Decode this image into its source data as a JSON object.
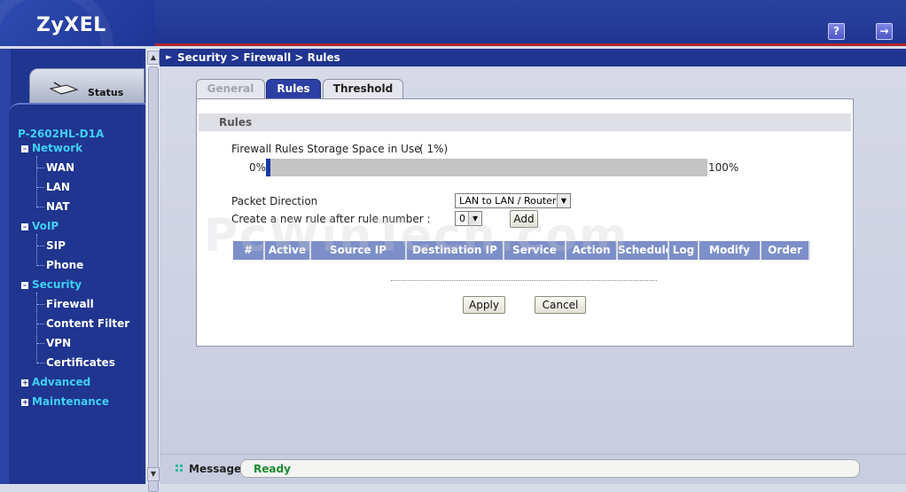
{
  "header": {
    "logo": "ZyXEL",
    "help_icon": "help-icon",
    "logout_icon": "logout-icon"
  },
  "sidebar": {
    "status_label": "Status",
    "model": "P-2602HL-D1A",
    "tree": [
      {
        "label": "Network",
        "expanded": true,
        "children": [
          "WAN",
          "LAN",
          "NAT"
        ]
      },
      {
        "label": "VoIP",
        "expanded": true,
        "children": [
          "SIP",
          "Phone"
        ]
      },
      {
        "label": "Security",
        "expanded": true,
        "children": [
          "Firewall",
          "Content Filter",
          "VPN",
          "Certificates"
        ]
      },
      {
        "label": "Advanced",
        "expanded": false,
        "children": []
      },
      {
        "label": "Maintenance",
        "expanded": false,
        "children": []
      }
    ]
  },
  "breadcrumb": "Security > Firewall > Rules",
  "tabs": [
    {
      "label": "General",
      "active": false
    },
    {
      "label": "Rules",
      "active": true
    },
    {
      "label": "Threshold",
      "active": false
    }
  ],
  "section_title": "Rules",
  "storage": {
    "label": "Firewall Rules Storage Space in Use",
    "percent_text": "( 1%)",
    "percent": 1,
    "min_label": "0%",
    "max_label": "100%"
  },
  "direction": {
    "label": "Packet Direction",
    "value": "LAN to LAN / Router"
  },
  "new_rule": {
    "label": "Create a new rule after rule number :",
    "value": "0",
    "add_label": "Add"
  },
  "table": {
    "headers": [
      "#",
      "Active",
      "Source IP",
      "Destination IP",
      "Service",
      "Action",
      "Schedule",
      "Log",
      "Modify",
      "Order"
    ],
    "rows": []
  },
  "buttons": {
    "apply": "Apply",
    "cancel": "Cancel"
  },
  "watermark": "PcWinTech.com",
  "footer": {
    "message_label": "Message",
    "message": "Ready"
  },
  "colors": {
    "header": "#1f3590",
    "accent_red": "#b0262a",
    "nav_category": "#3fd0f0",
    "bar_fill": "#1a38a8",
    "table_header": "#7c8fc8",
    "status_ok": "#1a8a2e"
  }
}
